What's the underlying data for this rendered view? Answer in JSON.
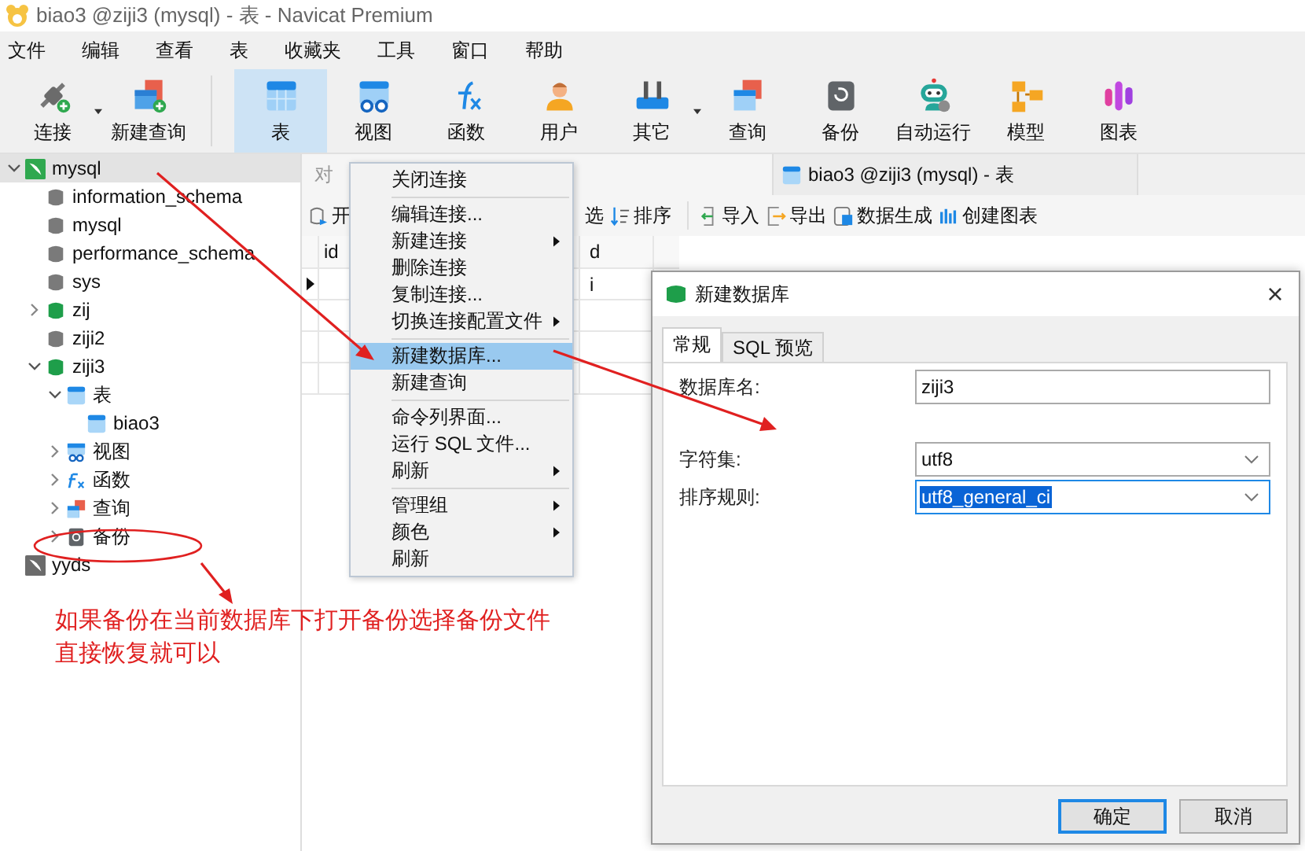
{
  "window": {
    "title": "biao3 @ziji3 (mysql) - 表 - Navicat Premium"
  },
  "menu": [
    "文件",
    "编辑",
    "查看",
    "表",
    "收藏夹",
    "工具",
    "窗口",
    "帮助"
  ],
  "toolbar": {
    "groups": [
      [
        {
          "label": "连接",
          "kind": "connect",
          "selected": false,
          "dropdown": true
        },
        {
          "label": "新建查询",
          "kind": "new-query",
          "selected": false,
          "dropdown": false
        }
      ],
      [
        {
          "label": "表",
          "kind": "table",
          "selected": true,
          "dropdown": false
        },
        {
          "label": "视图",
          "kind": "view",
          "selected": false,
          "dropdown": false
        },
        {
          "label": "函数",
          "kind": "function",
          "selected": false,
          "dropdown": false
        },
        {
          "label": "用户",
          "kind": "user",
          "selected": false,
          "dropdown": false
        },
        {
          "label": "其它",
          "kind": "tools",
          "selected": false,
          "dropdown": true
        },
        {
          "label": "查询",
          "kind": "query",
          "selected": false,
          "dropdown": false
        },
        {
          "label": "备份",
          "kind": "backup",
          "selected": false,
          "dropdown": false
        },
        {
          "label": "自动运行",
          "kind": "robot",
          "selected": false,
          "dropdown": false
        },
        {
          "label": "模型",
          "kind": "model",
          "selected": false,
          "dropdown": false
        },
        {
          "label": "图表",
          "kind": "chart",
          "selected": false,
          "dropdown": false
        }
      ]
    ]
  },
  "sidebar": {
    "items": [
      {
        "label": "mysql",
        "kind": "connection",
        "open": true,
        "selected": true,
        "expanded": true,
        "children": [
          {
            "label": "information_schema",
            "kind": "database",
            "open": false,
            "selected": false
          },
          {
            "label": "mysql",
            "kind": "database",
            "open": false,
            "selected": false
          },
          {
            "label": "performance_schema",
            "kind": "database",
            "open": false,
            "selected": false
          },
          {
            "label": "sys",
            "kind": "database",
            "open": false,
            "selected": false
          },
          {
            "label": "zij",
            "kind": "database",
            "open": true,
            "selected": false,
            "expanded": false
          },
          {
            "label": "ziji2",
            "kind": "database",
            "open": false,
            "selected": false
          },
          {
            "label": "ziji3",
            "kind": "database",
            "open": true,
            "selected": false,
            "expanded": true,
            "children": [
              {
                "label": "表",
                "kind": "tables",
                "selected": false,
                "expanded": true,
                "children": [
                  {
                    "label": "biao3",
                    "kind": "table",
                    "selected": false
                  }
                ]
              },
              {
                "label": "视图",
                "kind": "views",
                "selected": false,
                "expanded": false
              },
              {
                "label": "函数",
                "kind": "functions",
                "selected": false,
                "expanded": false
              },
              {
                "label": "查询",
                "kind": "queries",
                "selected": false,
                "expanded": false
              },
              {
                "label": "备份",
                "kind": "backups",
                "selected": false,
                "expanded": false
              }
            ]
          }
        ]
      },
      {
        "label": "yyds",
        "kind": "connection",
        "open": false,
        "selected": false
      }
    ]
  },
  "tabs": [
    {
      "label": "对",
      "selected": false
    },
    {
      "label": "biao3 @ziji3 (mysql) - 表",
      "selected": true
    }
  ],
  "table_toolbar": [
    {
      "label": "开",
      "kind": "begin"
    },
    {
      "label": "选",
      "kind": "plain"
    },
    {
      "label": "排序",
      "kind": "sort"
    },
    {
      "label": "导入",
      "kind": "import"
    },
    {
      "label": "导出",
      "kind": "export"
    },
    {
      "label": "数据生成",
      "kind": "generate"
    },
    {
      "label": "创建图表",
      "kind": "chart"
    }
  ],
  "grid": {
    "columns": [
      "id",
      "d"
    ],
    "rows": [
      {
        "current": true,
        "column_2": "i"
      },
      {
        "current": false
      },
      {
        "current": false
      },
      {
        "current": false
      }
    ]
  },
  "context_menu": {
    "groups": [
      [
        {
          "label": "关闭连接",
          "submenu": false,
          "selected": false
        }
      ],
      [
        {
          "label": "编辑连接...",
          "submenu": false,
          "selected": false
        },
        {
          "label": "新建连接",
          "submenu": true,
          "selected": false
        },
        {
          "label": "删除连接",
          "submenu": false,
          "selected": false
        },
        {
          "label": "复制连接...",
          "submenu": false,
          "selected": false
        },
        {
          "label": "切换连接配置文件",
          "submenu": true,
          "selected": false
        }
      ],
      [
        {
          "label": "新建数据库...",
          "submenu": false,
          "selected": true
        },
        {
          "label": "新建查询",
          "submenu": false,
          "selected": false
        }
      ],
      [
        {
          "label": "命令列界面...",
          "submenu": false,
          "selected": false
        },
        {
          "label": "运行 SQL 文件...",
          "submenu": false,
          "selected": false
        },
        {
          "label": "刷新",
          "submenu": true,
          "selected": false
        }
      ],
      [
        {
          "label": "管理组",
          "submenu": true,
          "selected": false
        },
        {
          "label": "颜色",
          "submenu": true,
          "selected": false
        },
        {
          "label": "刷新",
          "submenu": false,
          "selected": false
        }
      ]
    ]
  },
  "dialog": {
    "title": "新建数据库",
    "close": "×",
    "tabs": [
      {
        "label": "常规",
        "selected": true
      },
      {
        "label": "SQL 预览",
        "selected": false
      }
    ],
    "fields": [
      {
        "label": "数据库名:",
        "value": "ziji3",
        "kind": "text",
        "focused": false
      },
      {
        "label": "字符集:",
        "value": "utf8",
        "kind": "select",
        "focused": false
      },
      {
        "label": "排序规则:",
        "value": "utf8_general_ci",
        "kind": "select",
        "focused": true
      }
    ],
    "buttons": [
      {
        "label": "确定",
        "default": true
      },
      {
        "label": "取消",
        "default": false
      }
    ]
  },
  "annotation": {
    "lines": [
      "如果备份在当前数据库下打开备份选择备份文件",
      "直接恢复就可以"
    ]
  }
}
